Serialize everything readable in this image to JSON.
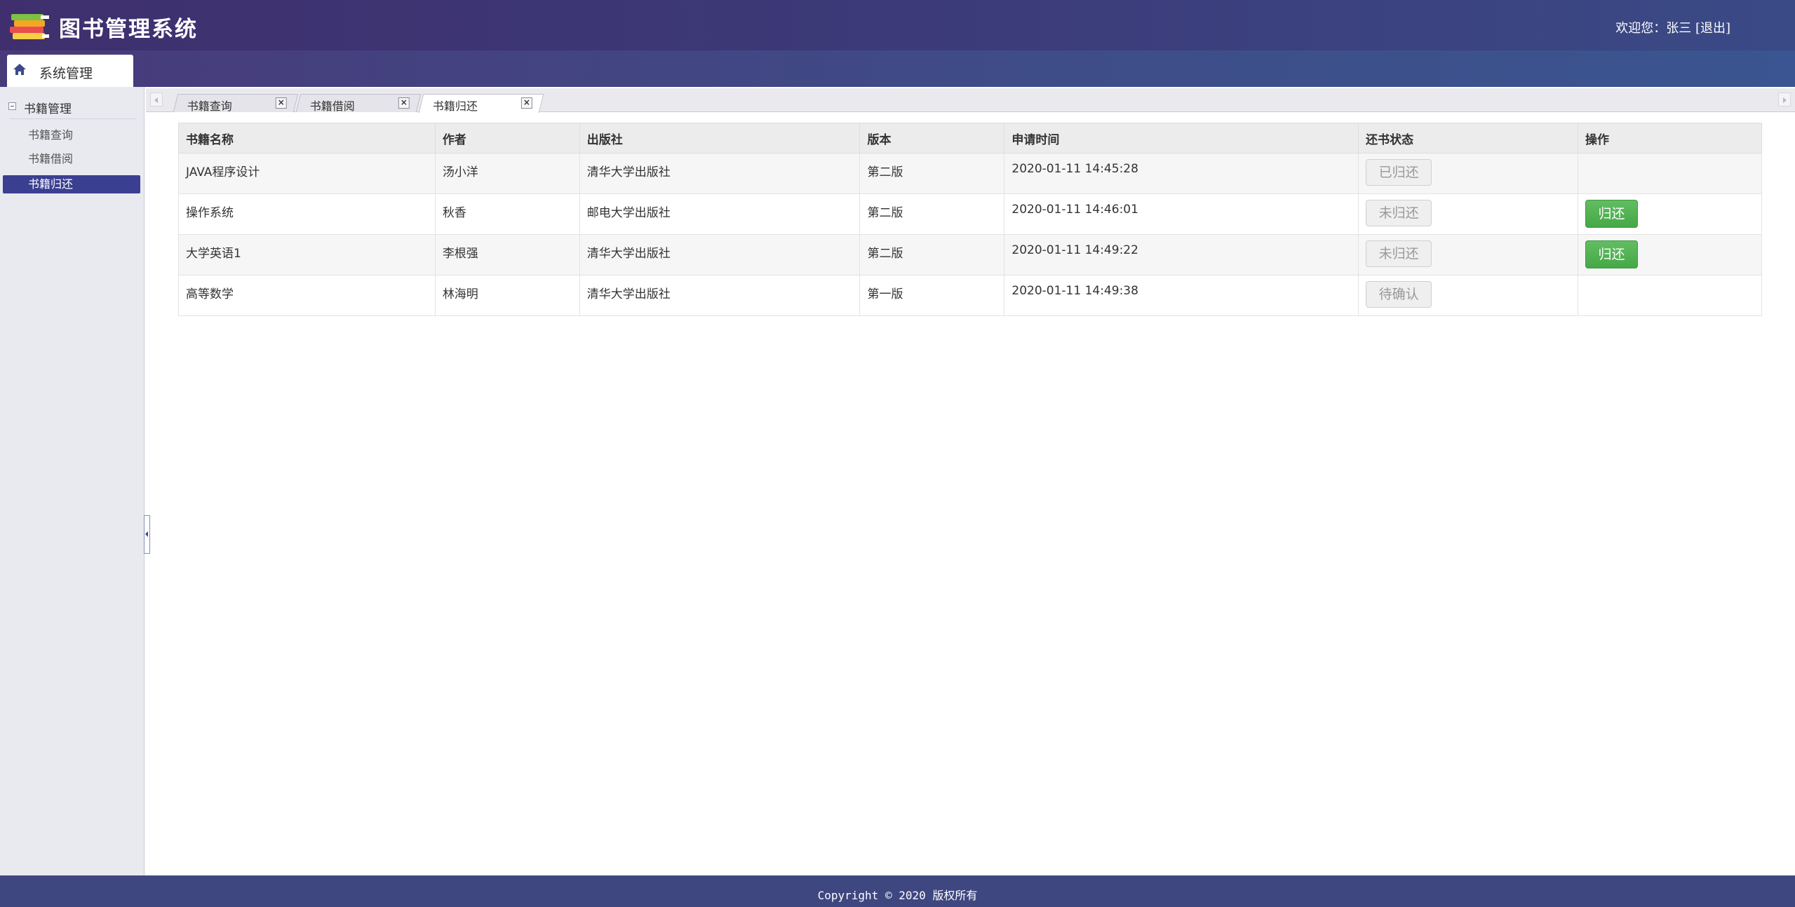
{
  "header": {
    "title": "图书管理系统",
    "welcome": "欢迎您：张三",
    "logout": "[退出]",
    "logo_icon": "books-icon"
  },
  "nav": {
    "system_tab": "系统管理",
    "home_icon": "home-icon"
  },
  "sidebar": {
    "group_label": "书籍管理",
    "items": [
      {
        "label": "书籍查询"
      },
      {
        "label": "书籍借阅"
      },
      {
        "label": "书籍归还"
      }
    ],
    "active_index": 2
  },
  "tabs": [
    {
      "label": "书籍查询",
      "close": "×"
    },
    {
      "label": "书籍借阅",
      "close": "×"
    },
    {
      "label": "书籍归还",
      "close": "×"
    }
  ],
  "active_tab": 2,
  "table": {
    "headers": [
      "书籍名称",
      "作者",
      "出版社",
      "版本",
      "申请时间",
      "还书状态",
      "操作"
    ],
    "rows": [
      {
        "name": "JAVA程序设计",
        "author": "汤小洋",
        "publisher": "清华大学出版社",
        "edition": "第二版",
        "time": "2020-01-11 14:45:28",
        "status": "已归还",
        "action": ""
      },
      {
        "name": "操作系统",
        "author": "秋香",
        "publisher": "邮电大学出版社",
        "edition": "第二版",
        "time": "2020-01-11 14:46:01",
        "status": "未归还",
        "action": "归还"
      },
      {
        "name": "大学英语1",
        "author": "李根强",
        "publisher": "清华大学出版社",
        "edition": "第二版",
        "time": "2020-01-11 14:49:22",
        "status": "未归还",
        "action": "归还"
      },
      {
        "name": "高等数学",
        "author": "林海明",
        "publisher": "清华大学出版社",
        "edition": "第一版",
        "time": "2020-01-11 14:49:38",
        "status": "待确认",
        "action": ""
      }
    ]
  },
  "footer": {
    "copyright": "Copyright © 2020 版权所有"
  },
  "colors": {
    "header_bg": "#3c3a78",
    "active_menu": "#3b3f92",
    "action_green": "#45a845",
    "footer_bg": "#3f4781"
  }
}
